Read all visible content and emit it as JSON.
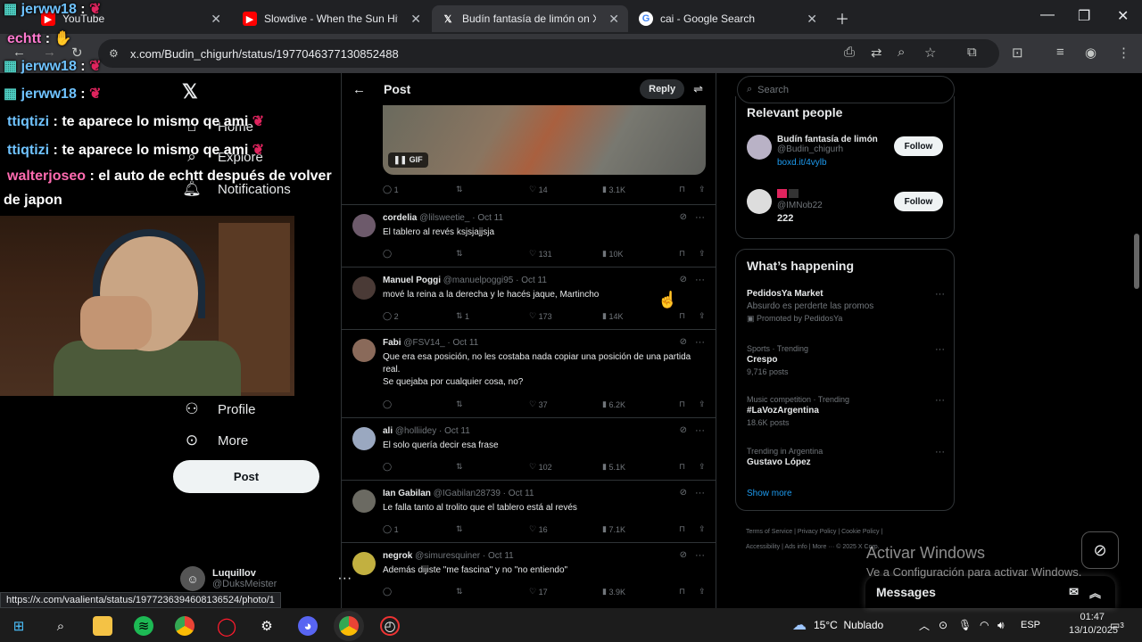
{
  "browser": {
    "tabs": [
      {
        "title": "YouTube",
        "icon": "youtube-icon"
      },
      {
        "title": "Slowdive - When the Sun Hits (",
        "icon": "youtube-icon"
      },
      {
        "title": "Budín fantasía de limón on X: \"",
        "icon": "x-logo-icon",
        "active": true
      },
      {
        "title": "cai - Google Search",
        "icon": "google-icon"
      }
    ],
    "url": "x.com/Budin_chigurh/status/1977046377130852488",
    "status_link": "https://x.com/vaalienta/status/1977236394608136524/photo/1"
  },
  "chat": [
    {
      "user": "jerww18",
      "sep": ":",
      "text": "",
      "top": 0
    },
    {
      "user": "echtt",
      "sep": ":",
      "text": "",
      "top": 0
    },
    {
      "user": "jerww18",
      "sep": ":",
      "text": "",
      "top": 0
    },
    {
      "user": "jerww18",
      "sep": ":",
      "text": "",
      "top": 0
    },
    {
      "user": "ttiqtizi",
      "sep": ":",
      "text": "te aparece lo mismo qe ami"
    },
    {
      "user": "ttiqtizi",
      "sep": ":",
      "text": "te aparece lo mismo qe ami"
    },
    {
      "user": "walterjoseo",
      "sep": ":",
      "text": "el auto de echtt después de volver"
    },
    {
      "user": "",
      "sep": "",
      "text": "de japon"
    }
  ],
  "leftnav": {
    "items": [
      {
        "label": "Home",
        "icon": "home-icon"
      },
      {
        "label": "Explore",
        "icon": "search-icon"
      },
      {
        "label": "Notifications",
        "icon": "bell-icon"
      },
      {
        "label": "Profile",
        "icon": "profile-icon"
      },
      {
        "label": "More",
        "icon": "more-circle-icon"
      }
    ],
    "post_label": "Post",
    "account": {
      "name": "Luquillov",
      "handle": "@DuksMeister"
    }
  },
  "timeline": {
    "title": "Post",
    "reply_label": "Reply",
    "gif_label": "GIF",
    "main_actions": {
      "replies": "1",
      "reposts": "",
      "likes": "14",
      "views": "3.1K"
    },
    "replies": [
      {
        "name": "cordelia",
        "handle": "@lilsweetie_",
        "date": "Oct 11",
        "text": "El tablero al revés ksjsjajjsja",
        "replies": "",
        "reposts": "",
        "likes": "131",
        "views": "10K",
        "color": "#6d5a6b"
      },
      {
        "name": "Manuel Poggi",
        "handle": "@manuelpoggi95",
        "date": "Oct 11",
        "text": "mové la reina a la derecha y le hacés jaque, Martincho",
        "replies": "2",
        "reposts": "1",
        "likes": "173",
        "views": "14K",
        "color": "#4a3a36"
      },
      {
        "name": "Fabi",
        "handle": "@FSV14_",
        "date": "Oct 11",
        "text": "Que era esa posición, no les costaba nada copiar una posición de una partida real.\nSe quejaba por cualquier cosa, no?",
        "replies": "",
        "reposts": "",
        "likes": "37",
        "views": "6.2K",
        "color": "#8a6a5a"
      },
      {
        "name": "ali",
        "handle": "@holliidey",
        "date": "Oct 11",
        "text": "El solo quería decir esa frase",
        "replies": "",
        "reposts": "",
        "likes": "102",
        "views": "5.1K",
        "color": "#9aa8c0"
      },
      {
        "name": "Ian Gabilan",
        "handle": "@IGabilan28739",
        "date": "Oct 11",
        "text": "Le falla tanto al trolito que el tablero está al revés",
        "replies": "1",
        "reposts": "",
        "likes": "16",
        "views": "7.1K",
        "color": "#6b6a62"
      },
      {
        "name": "negrok",
        "handle": "@simuresquiner",
        "date": "Oct 11",
        "text": "Además dijiste \"me fascina\" y no \"no entiendo\"",
        "replies": "",
        "reposts": "",
        "likes": "17",
        "views": "3.9K",
        "color": "#c2b040"
      }
    ]
  },
  "right": {
    "search_placeholder": "Search",
    "relevant_title": "Relevant people",
    "people": [
      {
        "name": "Budín fantasía de limón",
        "handle": "@Budin_chigurh",
        "link": "boxd.it/4vylb",
        "follow": "Follow"
      },
      {
        "name": "",
        "handle": "@IMNob22",
        "link": "222",
        "follow": "Follow"
      }
    ],
    "happening_title": "What’s happening",
    "trends": [
      {
        "cat": "",
        "name": "PedidosYa Market",
        "sub": "Absurdo es perderte las promos",
        "sub2": "Promoted by PedidosYa"
      },
      {
        "cat": "Sports · Trending",
        "name": "Crespo",
        "sub": "9,716 posts",
        "sub2": ""
      },
      {
        "cat": "Music competition · Trending",
        "name": "#LaVozArgentina",
        "sub": "18.6K posts",
        "sub2": ""
      },
      {
        "cat": "Trending in Argentina",
        "name": "Gustavo López",
        "sub": "",
        "sub2": ""
      }
    ],
    "show_more": "Show more",
    "footer_line1": "Terms of Service  |  Privacy Policy  |  Cookie Policy  |",
    "footer_line2": "Accessibility  |  Ads info  |  More ···  © 2025 X Corp."
  },
  "overlay": {
    "activate_title": "Activar Windows",
    "activate_sub": "Ve a Configuración para activar Windows.",
    "messages": "Messages"
  },
  "taskbar": {
    "weather_temp": "15°C",
    "weather_text": "Nublado",
    "lang": "ESP",
    "time": "01:47",
    "date": "13/10/2025",
    "notif_count": "3"
  },
  "colors": {
    "accent": "#1d9bf0",
    "background": "#000000",
    "border": "#2f3336"
  }
}
